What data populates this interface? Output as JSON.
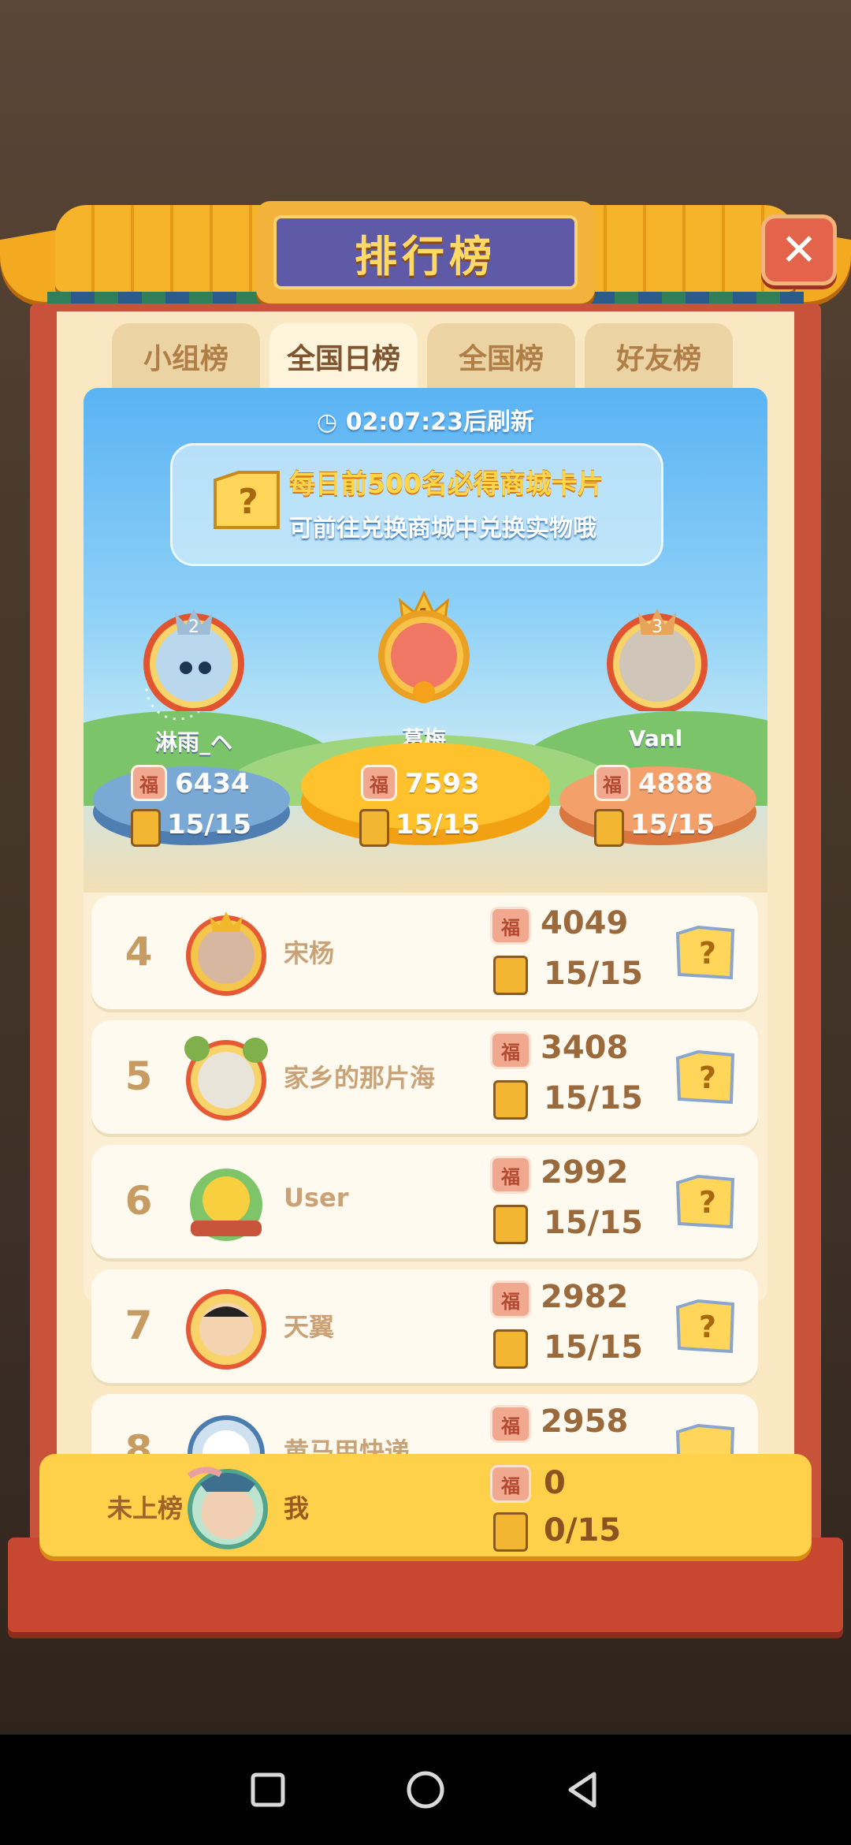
{
  "title": "排行榜",
  "close_label": "✕",
  "tabs": [
    {
      "label": "小组榜"
    },
    {
      "label": "全国日榜"
    },
    {
      "label": "全国榜"
    },
    {
      "label": "好友榜"
    }
  ],
  "refresh_text": "02:07:23后刷新",
  "banner": {
    "line1": "每日前500名必得商城卡片",
    "line2": "可前往兑换商城中兑换实物哦",
    "icon_glyph": "?"
  },
  "podium": [
    {
      "rank": "2",
      "name": "淋雨_ヘ",
      "score": "6434",
      "count": "15/15"
    },
    {
      "rank": "1",
      "name": "葛梅",
      "score": "7593",
      "count": "15/15"
    },
    {
      "rank": "3",
      "name": "Vanl",
      "score": "4888",
      "count": "15/15"
    }
  ],
  "fu_glyph": "福",
  "rows": [
    {
      "rank": "4",
      "name": "宋杨",
      "score": "4049",
      "count": "15/15"
    },
    {
      "rank": "5",
      "name": "家乡的那片海",
      "score": "3408",
      "count": "15/15"
    },
    {
      "rank": "6",
      "name": "User",
      "score": "2992",
      "count": "15/15"
    },
    {
      "rank": "7",
      "name": "天翼",
      "score": "2982",
      "count": "15/15"
    },
    {
      "rank": "8",
      "name": "黄马甲快递",
      "score": "2958",
      "count": ""
    }
  ],
  "me": {
    "rank_text": "未上榜",
    "name": "我",
    "score": "0",
    "count": "0/15"
  },
  "colors": {
    "accent": "#ffd04a",
    "frame": "#c9523a",
    "panel": "#fbeed3",
    "rank_text": "#c79c63"
  },
  "nav_icons": [
    "square-icon",
    "circle-icon",
    "back-triangle-icon"
  ]
}
